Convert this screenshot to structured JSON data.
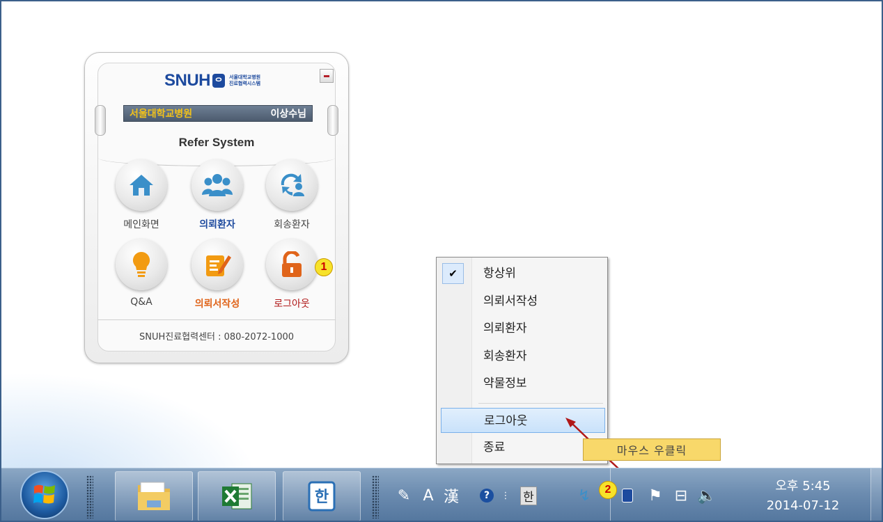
{
  "widget": {
    "logo_text": "SNUH",
    "logo_sub_line1": "서울대학교병원",
    "logo_sub_line2": "진료협력시스템",
    "hospital_name": "서울대학교병원",
    "user_name": "이상수님",
    "title": "Refer System",
    "tiles": [
      {
        "label": "메인화면",
        "icon": "home-icon"
      },
      {
        "label": "의뢰환자",
        "icon": "patients-icon"
      },
      {
        "label": "회송환자",
        "icon": "return-patient-icon"
      },
      {
        "label": "Q&A",
        "icon": "lightbulb-icon"
      },
      {
        "label": "의뢰서작성",
        "icon": "edit-document-icon"
      },
      {
        "label": "로그아웃",
        "icon": "unlock-icon"
      }
    ],
    "footer": "SNUH진료협력센터 : 080-2072-1000",
    "badge_1": "1"
  },
  "context_menu": {
    "items": [
      {
        "label": "항상위",
        "checked": true
      },
      {
        "label": "의뢰서작성"
      },
      {
        "label": "의뢰환자"
      },
      {
        "label": "회송환자"
      },
      {
        "label": "약물정보"
      },
      {
        "label": "로그아웃",
        "highlighted": true
      },
      {
        "label": "종료"
      }
    ]
  },
  "tooltip": "마우스 우클릭",
  "badge_2": "2",
  "taskbar": {
    "clock_time": "오후 5:45",
    "clock_date": "2014-07-12",
    "ime_a": "A",
    "ime_hanja": "漢",
    "ime_han": "한"
  },
  "colors": {
    "brand_blue": "#1d4a9e",
    "accent_orange": "#e0641a",
    "highlight": "#c9e2fb",
    "tooltip": "#f8d86a",
    "arrow": "#b01818"
  }
}
